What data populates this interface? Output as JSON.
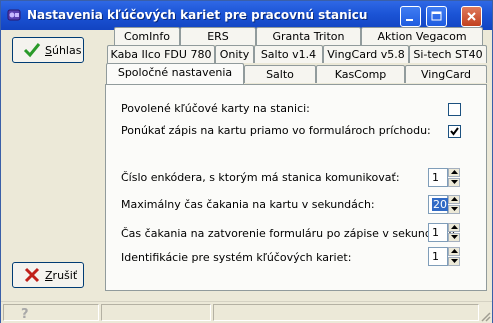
{
  "window": {
    "title": "Nastavenia kľúčových kariet pre pracovnú stanicu"
  },
  "buttons": {
    "ok_prefix": "S",
    "ok_rest": "úhlas",
    "cancel_prefix": "Z",
    "cancel_rest": "rušiť"
  },
  "tabs": {
    "row1": [
      "ComInfo",
      "ERS",
      "Granta Triton",
      "Aktion Vegacom"
    ],
    "row2": [
      "Kaba Ilco FDU 780",
      "Onity",
      "Salto v1.4",
      "VingCard v5.8",
      "Si-tech ST40"
    ],
    "row3": [
      "Spoločné nastavenia",
      "Salto",
      "KasComp",
      "VingCard"
    ],
    "active": "Spoločné nastavenia"
  },
  "settings": {
    "allowed_cards_label": "Povolené kľúčové karty na stanici:",
    "allowed_cards_checked": false,
    "offer_write_label": "Ponúkať zápis na kartu priamo vo formulároch príchodu:",
    "offer_write_checked": true,
    "encoder_label": "Číslo enkódera, s ktorým má stanica komunikovať:",
    "encoder_value": "1",
    "max_wait_label": "Maximálny čas čakania na kartu v sekundách:",
    "max_wait_value": "20",
    "close_wait_label": "Čas čakania na zatvorenie formuláru po zápise v sekundách:",
    "close_wait_value": "1",
    "ident_label": "Identifikácie pre systém kľúčových kariet:",
    "ident_value": "1"
  },
  "icons": {
    "app": "key-card-icon",
    "ok": "check-icon",
    "cancel": "x-icon",
    "status": "help-icon"
  },
  "colors": {
    "titlebar": "#1b54d6",
    "ok_check": "#2a9a2a",
    "cancel_x": "#c0201a",
    "selection": "#316ac5"
  }
}
